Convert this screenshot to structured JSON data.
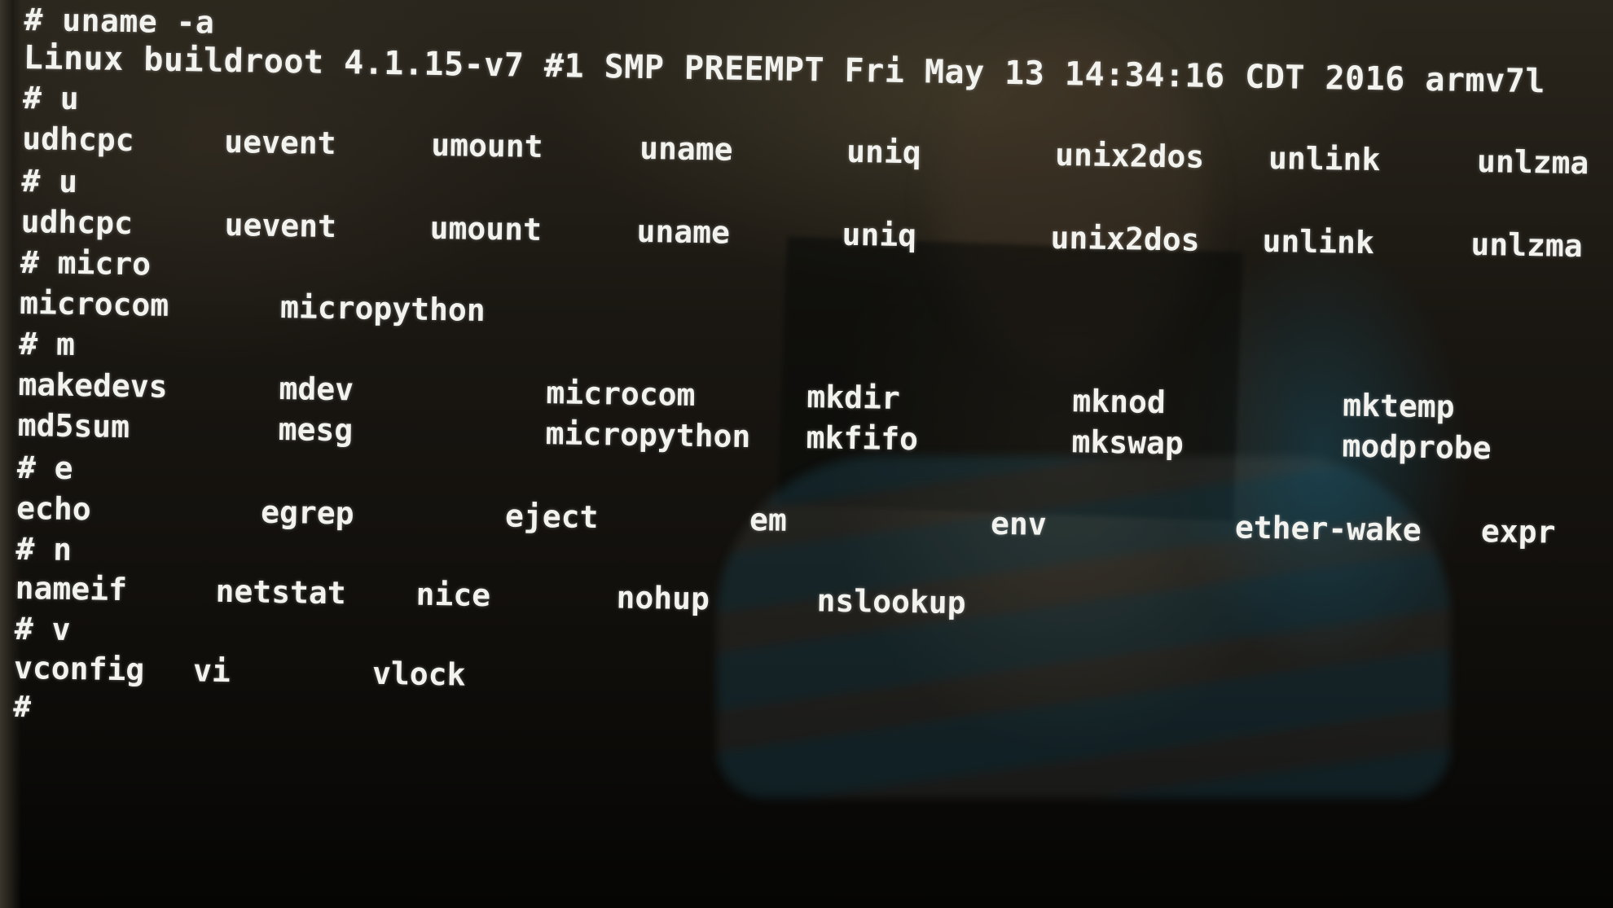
{
  "terminal": {
    "lines": [
      {
        "type": "prompt",
        "text": "# uname -a"
      },
      {
        "type": "output",
        "text": "Linux buildroot 4.1.15-v7 #1 SMP PREEMPT Fri May 13 14:34:16 CDT 2016 armv7l"
      },
      {
        "type": "prompt",
        "text": "# u"
      },
      {
        "type": "completions",
        "items": [
          "udhcpc",
          "uevent",
          "umount",
          "uname",
          "uniq",
          "unix2dos",
          "unlink",
          "unlzma"
        ]
      },
      {
        "type": "prompt",
        "text": "# u"
      },
      {
        "type": "completions",
        "items": [
          "udhcpc",
          "uevent",
          "umount",
          "uname",
          "uniq",
          "unix2dos",
          "unlink",
          "unlzma"
        ]
      },
      {
        "type": "prompt",
        "text": "# micro"
      },
      {
        "type": "completions",
        "items": [
          "microcom",
          "micropython"
        ]
      },
      {
        "type": "prompt",
        "text": "# m"
      },
      {
        "type": "completions",
        "items": [
          "makedevs",
          "mdev",
          "microcom",
          "mkdir",
          "mknod",
          "mktemp"
        ]
      },
      {
        "type": "completions",
        "items": [
          "md5sum",
          "mesg",
          "micropython",
          "mkfifo",
          "mkswap",
          "modprobe"
        ]
      },
      {
        "type": "prompt",
        "text": "# e"
      },
      {
        "type": "completions",
        "items": [
          "echo",
          "egrep",
          "eject",
          "em",
          "env",
          "ether-wake",
          "expr"
        ]
      },
      {
        "type": "prompt",
        "text": "# n"
      },
      {
        "type": "completions",
        "items": [
          "nameif",
          "netstat",
          "nice",
          "nohup",
          "nslookup"
        ]
      },
      {
        "type": "prompt",
        "text": "# v"
      },
      {
        "type": "completions",
        "items": [
          "vconfig",
          "vi",
          "vlock"
        ]
      },
      {
        "type": "prompt",
        "text": "#"
      }
    ]
  },
  "colors": {
    "text": "#f2f2ee",
    "background": "#0b0a08"
  }
}
